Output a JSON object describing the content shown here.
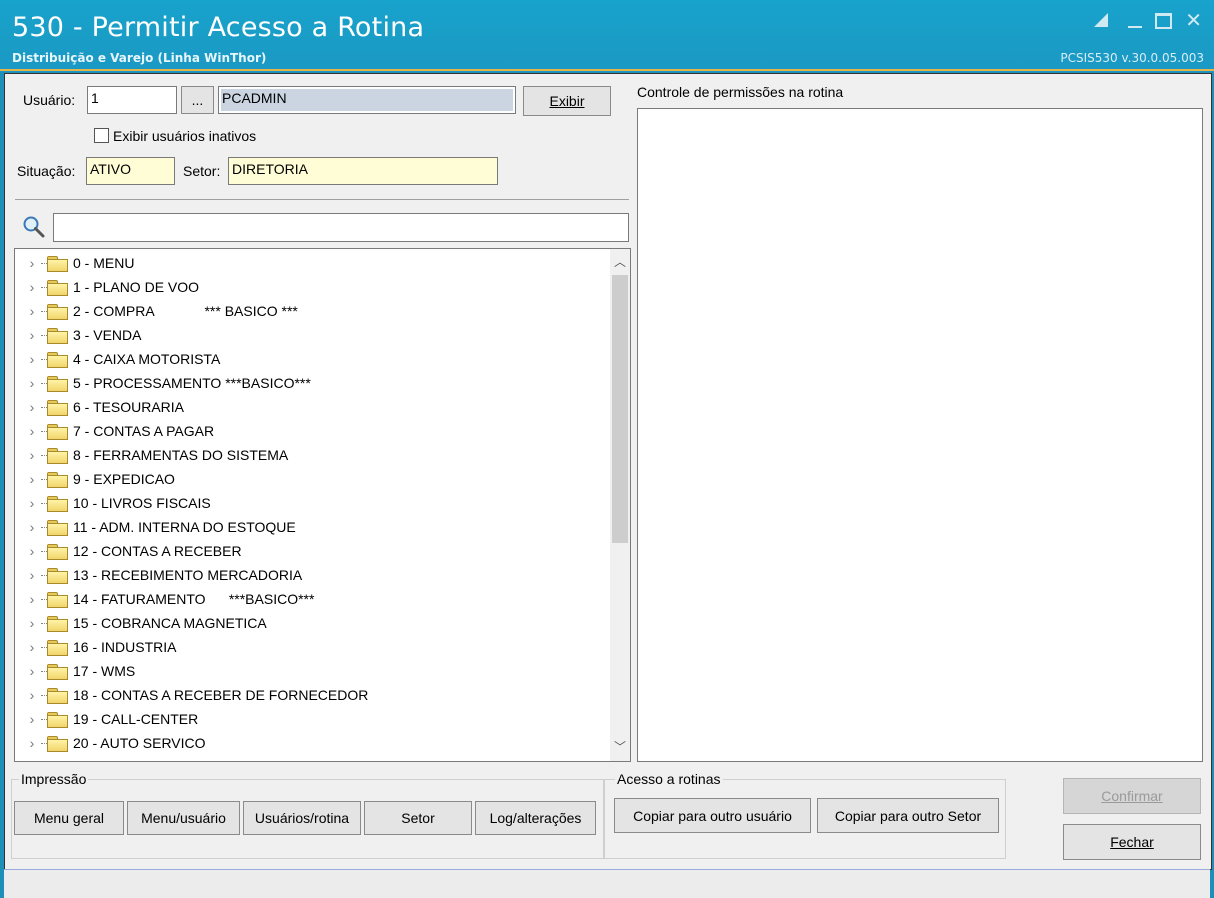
{
  "window": {
    "title": "530 - Permitir Acesso a Rotina",
    "subtitle": "Distribuição e Varejo (Linha WinThor)",
    "version": "PCSIS530  v.30.0.05.003",
    "close_glyph": "✕"
  },
  "user": {
    "label": "Usuário:",
    "code": "1",
    "lookup_button": "...",
    "name": "PCADMIN",
    "show_button": "Exibir",
    "inactive_label": "Exibir usuários inativos",
    "situation_label": "Situação:",
    "situation_value": "ATIVO",
    "sector_label": "Setor:",
    "sector_value": "DIRETORIA"
  },
  "search": {
    "placeholder": "",
    "value": ""
  },
  "tree": {
    "items": [
      "0 - MENU",
      "1 - PLANO DE VOO",
      "2 - COMPRA             *** BASICO ***",
      "3 - VENDA",
      "4 - CAIXA MOTORISTA",
      "5 - PROCESSAMENTO ***BASICO***",
      "6 - TESOURARIA",
      "7 - CONTAS A PAGAR",
      "8 - FERRAMENTAS DO SISTEMA",
      "9 - EXPEDICAO",
      "10 - LIVROS FISCAIS",
      "11 - ADM. INTERNA DO ESTOQUE",
      "12 - CONTAS A RECEBER",
      "13 - RECEBIMENTO MERCADORIA",
      "14 - FATURAMENTO      ***BASICO***",
      "15 - COBRANCA MAGNETICA",
      "16 - INDUSTRIA",
      "17 - WMS",
      "18 - CONTAS A RECEBER DE FORNECEDOR",
      "19 - CALL-CENTER",
      "20 - AUTO SERVICO"
    ]
  },
  "permissions": {
    "title": "Controle de permissões na rotina"
  },
  "print_group": {
    "title": "Impressão",
    "buttons": [
      "Menu geral",
      "Menu/usuário",
      "Usuários/rotina",
      "Setor",
      "Log/alterações"
    ]
  },
  "access_group": {
    "title": "Acesso a rotinas",
    "copy_user": "Copiar para outro usuário",
    "copy_sector": "Copiar para outro Setor"
  },
  "actions": {
    "confirm": "Confirmar",
    "close": "Fechar"
  }
}
